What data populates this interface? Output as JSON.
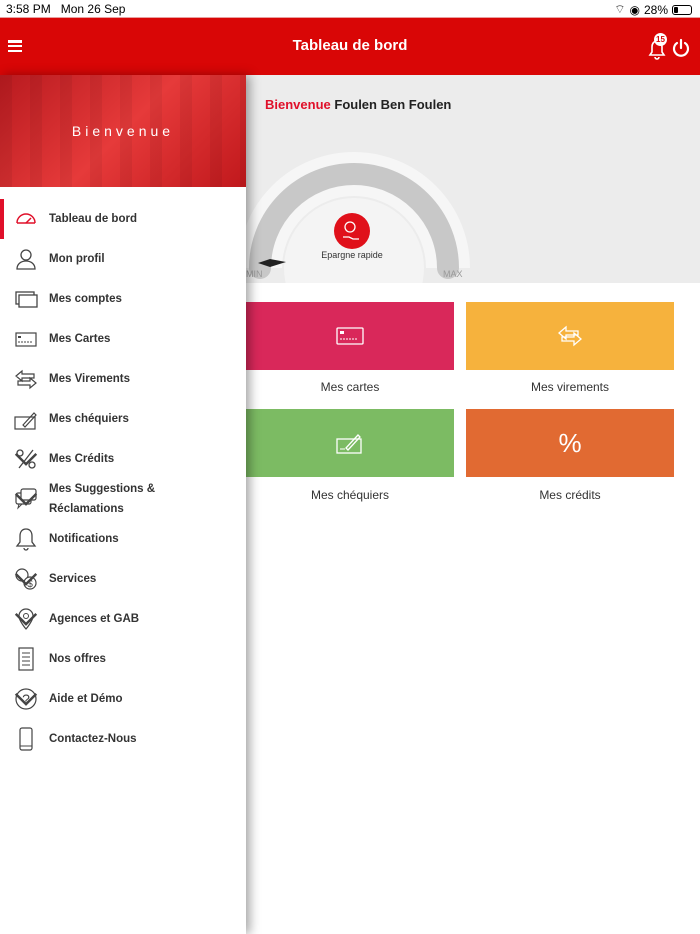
{
  "status_bar": {
    "time": "3:58 PM",
    "date": "Mon 26 Sep",
    "battery": "28%",
    "battery_level": 0.28
  },
  "header": {
    "title": "Tableau de bord",
    "notification_count": "15"
  },
  "sidebar": {
    "banner": "Bienvenue",
    "items": [
      {
        "label": "Tableau de bord",
        "icon": "gauge-icon",
        "active": true
      },
      {
        "label": "Mon profil",
        "icon": "user-icon"
      },
      {
        "label": "Mes comptes",
        "icon": "accounts-icon"
      },
      {
        "label": "Mes Cartes",
        "icon": "card-icon"
      },
      {
        "label": "Mes Virements",
        "icon": "transfer-icon"
      },
      {
        "label": "Mes chéquiers",
        "icon": "checkbook-icon"
      },
      {
        "label": "Mes Crédits",
        "icon": "percent-icon",
        "expandable": true
      },
      {
        "label": "Mes Suggestions & Réclamations",
        "icon": "chat-icon",
        "expandable": true
      },
      {
        "label": "Notifications",
        "icon": "bell-icon"
      },
      {
        "label": "Services",
        "icon": "currency-icon",
        "expandable": true
      },
      {
        "label": "Agences et GAB",
        "icon": "location-icon",
        "expandable": true
      },
      {
        "label": "Nos offres",
        "icon": "list-icon"
      },
      {
        "label": "Aide et Démo",
        "icon": "help-icon",
        "expandable": true
      },
      {
        "label": "Contactez-Nous",
        "icon": "phone-icon"
      }
    ]
  },
  "main": {
    "welcome_prefix": "Bienvenue",
    "user_name": "Foulen Ben Foulen",
    "gauge": {
      "label": "Epargne rapide",
      "min": "MIN",
      "max": "MAX",
      "value": 0
    },
    "tiles": [
      {
        "label": "Mes cartes",
        "color": "#d9285a"
      },
      {
        "label": "Mes virements",
        "color": "#f6b23d"
      },
      {
        "label": "Mes chéquiers",
        "color": "#7cbb63"
      },
      {
        "label": "Mes crédits",
        "color": "#e16a32"
      }
    ]
  }
}
